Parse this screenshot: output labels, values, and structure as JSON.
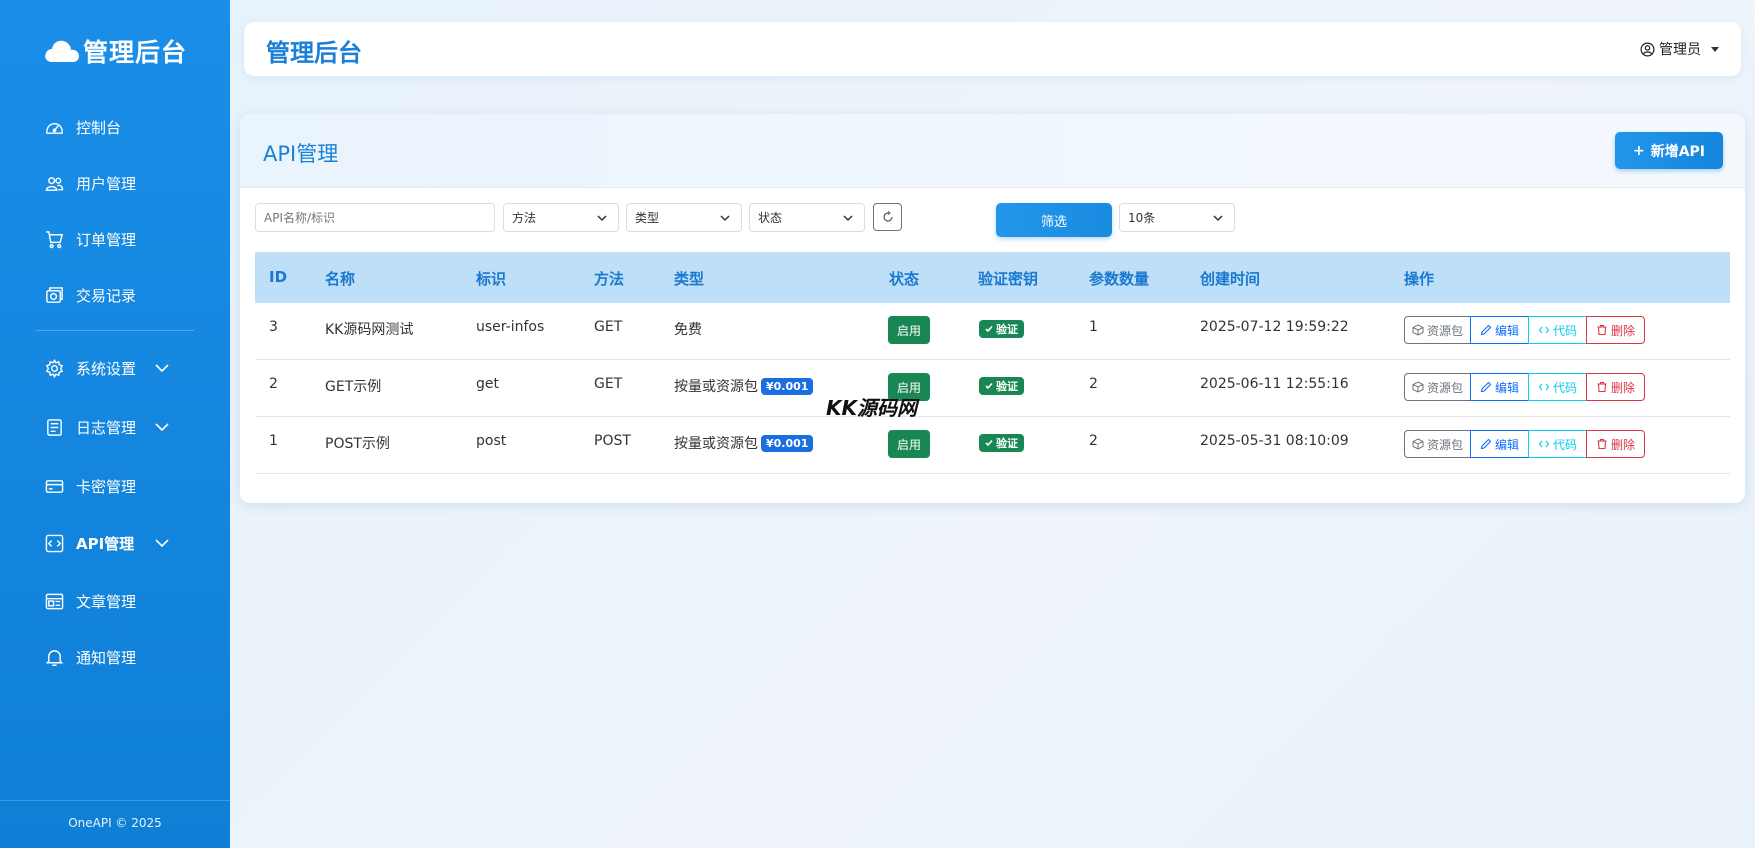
{
  "sidebar": {
    "brand": "管理后台",
    "items": [
      {
        "label": "控制台",
        "icon": "dashboard-icon"
      },
      {
        "label": "用户管理",
        "icon": "users-icon"
      },
      {
        "label": "订单管理",
        "icon": "cart-icon"
      },
      {
        "label": "交易记录",
        "icon": "transaction-icon"
      },
      {
        "label": "系统设置",
        "icon": "gear-icon"
      },
      {
        "label": "日志管理",
        "icon": "log-icon"
      },
      {
        "label": "卡密管理",
        "icon": "card-icon"
      },
      {
        "label": "API管理",
        "icon": "code-icon"
      },
      {
        "label": "文章管理",
        "icon": "article-icon"
      },
      {
        "label": "通知管理",
        "icon": "bell-icon"
      }
    ],
    "footer": "OneAPI © 2025"
  },
  "header": {
    "title": "管理后台",
    "user": "管理员"
  },
  "main": {
    "title": "API管理",
    "add_button": "新增API",
    "filters": {
      "search_placeholder": "API名称/标识",
      "method": "方法",
      "type": "类型",
      "status": "状态",
      "filter_button": "筛选",
      "page_size": "10条"
    },
    "table": {
      "columns": [
        "ID",
        "名称",
        "标识",
        "方法",
        "类型",
        "状态",
        "验证密钥",
        "参数数量",
        "创建时间",
        "操作"
      ],
      "rows": [
        {
          "id": "3",
          "name": "KK源码网测试",
          "key": "user-infos",
          "method": "GET",
          "type": "免费",
          "price": "",
          "status": "启用",
          "verify": "验证",
          "params": "1",
          "created": "2025-07-12 19:59:22"
        },
        {
          "id": "2",
          "name": "GET示例",
          "key": "get",
          "method": "GET",
          "type": "按量或资源包",
          "price": "¥0.001",
          "status": "启用",
          "verify": "验证",
          "params": "2",
          "created": "2025-06-11 12:55:16"
        },
        {
          "id": "1",
          "name": "POST示例",
          "key": "post",
          "method": "POST",
          "type": "按量或资源包",
          "price": "¥0.001",
          "status": "启用",
          "verify": "验证",
          "params": "2",
          "created": "2025-05-31 08:10:09"
        }
      ],
      "actions": {
        "package": "资源包",
        "edit": "编辑",
        "code": "代码",
        "delete": "删除"
      }
    },
    "watermark": "KK源码网"
  },
  "colors": {
    "primary": "#1a7fd6",
    "sidebar": "#1a8ee8",
    "success": "#198754",
    "danger": "#dc3545",
    "info": "#0dcaf0"
  }
}
